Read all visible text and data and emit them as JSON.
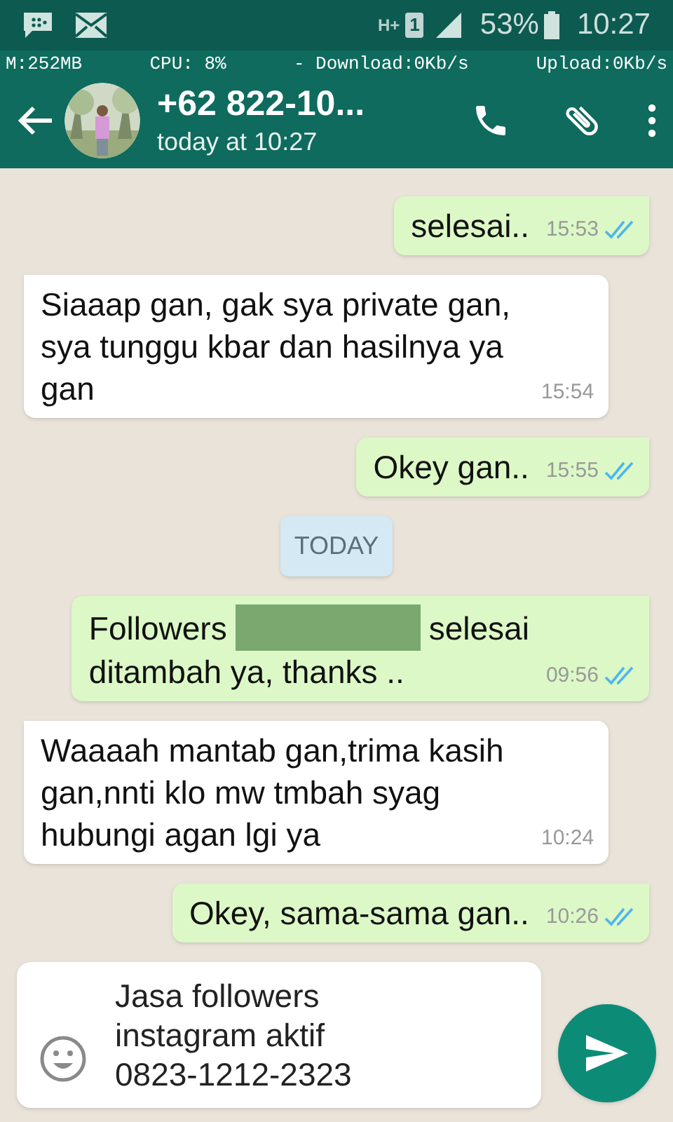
{
  "status_bar": {
    "network": "H+",
    "sim": "1",
    "battery": "53%",
    "time": "10:27"
  },
  "monitor": [
    "M:252MB",
    "CPU: 8%",
    "- Download:0Kb/s",
    "Upload:0Kb/s"
  ],
  "header": {
    "title": "+62 822-10...",
    "subtitle": "today at 10:27"
  },
  "messages": [
    {
      "kind": "out",
      "text": "selesai..",
      "time": "15:53",
      "read": true
    },
    {
      "kind": "in",
      "text": "Siaaap gan, gak sya private gan, sya tunggu kbar dan hasilnya ya gan",
      "time": "15:54"
    },
    {
      "kind": "out",
      "text": "Okey gan..",
      "time": "15:55",
      "read": true
    },
    {
      "kind": "date",
      "text": "TODAY"
    },
    {
      "kind": "out",
      "text": "Followers",
      "redacted": true,
      "text_after": "selesai",
      "text_continued": "ditambah ya, thanks ..",
      "time": "09:56",
      "read": true
    },
    {
      "kind": "in",
      "text": "Waaaah mantab gan,trima kasih gan,nnti klo mw tmbah syag hubungi agan lgi ya",
      "time": "10:24"
    },
    {
      "kind": "out",
      "text": "Okey, sama-sama gan..",
      "time": "10:26",
      "read": true
    }
  ],
  "composer": {
    "value": "Jasa followers\ninstagram aktif\n0823-1212-2323"
  }
}
